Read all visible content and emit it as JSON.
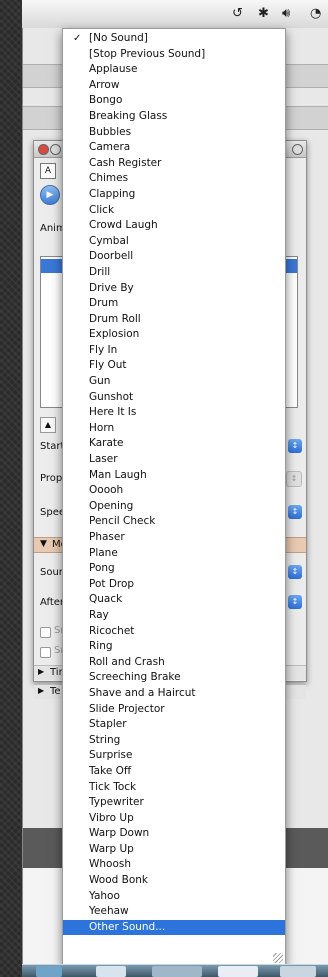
{
  "menubar": {
    "icons": [
      "time-machine-icon",
      "bluetooth-icon",
      "volume-icon",
      "wifi-icon"
    ]
  },
  "inspector": {
    "labels": {
      "animations": "Anim",
      "start": "Start:",
      "properties": "Prope",
      "speed": "Speec",
      "more": "Mo",
      "sound": "Sounc",
      "after": "After",
      "sn1": "Sr",
      "sn2": "Sr",
      "timing": "Tir",
      "text": "Te"
    }
  },
  "sound_menu": {
    "items": [
      {
        "label": "[No Sound]",
        "checked": true
      },
      {
        "label": "[Stop Previous Sound]"
      },
      {
        "label": "Applause"
      },
      {
        "label": "Arrow"
      },
      {
        "label": "Bongo"
      },
      {
        "label": "Breaking Glass"
      },
      {
        "label": "Bubbles"
      },
      {
        "label": "Camera"
      },
      {
        "label": "Cash Register"
      },
      {
        "label": "Chimes"
      },
      {
        "label": "Clapping"
      },
      {
        "label": "Click"
      },
      {
        "label": "Crowd Laugh"
      },
      {
        "label": "Cymbal"
      },
      {
        "label": "Doorbell"
      },
      {
        "label": "Drill"
      },
      {
        "label": "Drive By"
      },
      {
        "label": "Drum"
      },
      {
        "label": "Drum Roll"
      },
      {
        "label": "Explosion"
      },
      {
        "label": "Fly In"
      },
      {
        "label": "Fly Out"
      },
      {
        "label": "Gun"
      },
      {
        "label": "Gunshot"
      },
      {
        "label": "Here It Is"
      },
      {
        "label": "Horn"
      },
      {
        "label": "Karate"
      },
      {
        "label": "Laser"
      },
      {
        "label": "Man Laugh"
      },
      {
        "label": "Ooooh"
      },
      {
        "label": "Opening"
      },
      {
        "label": "Pencil Check"
      },
      {
        "label": "Phaser"
      },
      {
        "label": "Plane"
      },
      {
        "label": "Pong"
      },
      {
        "label": "Pot Drop"
      },
      {
        "label": "Quack"
      },
      {
        "label": "Ray"
      },
      {
        "label": "Ricochet"
      },
      {
        "label": "Ring"
      },
      {
        "label": "Roll and Crash"
      },
      {
        "label": "Screeching Brake"
      },
      {
        "label": "Shave and a Haircut"
      },
      {
        "label": "Slide Projector"
      },
      {
        "label": "Stapler"
      },
      {
        "label": "String"
      },
      {
        "label": "Surprise"
      },
      {
        "label": "Take Off"
      },
      {
        "label": "Tick Tock"
      },
      {
        "label": "Typewriter"
      },
      {
        "label": "Vibro Up"
      },
      {
        "label": "Warp Down"
      },
      {
        "label": "Warp Up"
      },
      {
        "label": "Whoosh"
      },
      {
        "label": "Wood Bonk"
      },
      {
        "label": "Yahoo"
      },
      {
        "label": "Yeehaw"
      },
      {
        "label": "Other Sound...",
        "highlighted": true
      }
    ]
  },
  "colors": {
    "highlight": "#2c74dc",
    "menubar": "#e6e6e6",
    "dock": "#5b7b90"
  }
}
